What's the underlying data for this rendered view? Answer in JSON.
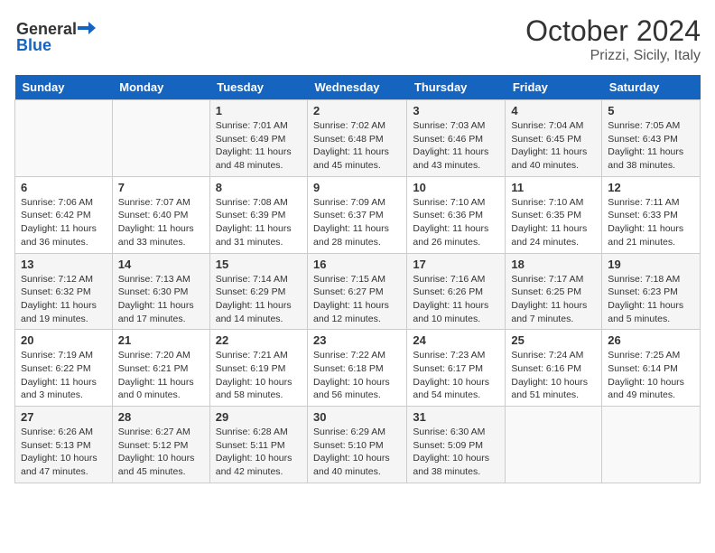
{
  "logo": {
    "line1": "General",
    "line2": "Blue"
  },
  "title": "October 2024",
  "subtitle": "Prizzi, Sicily, Italy",
  "days_of_week": [
    "Sunday",
    "Monday",
    "Tuesday",
    "Wednesday",
    "Thursday",
    "Friday",
    "Saturday"
  ],
  "weeks": [
    [
      {
        "day": "",
        "info": ""
      },
      {
        "day": "",
        "info": ""
      },
      {
        "day": "1",
        "info": "Sunrise: 7:01 AM\nSunset: 6:49 PM\nDaylight: 11 hours and 48 minutes."
      },
      {
        "day": "2",
        "info": "Sunrise: 7:02 AM\nSunset: 6:48 PM\nDaylight: 11 hours and 45 minutes."
      },
      {
        "day": "3",
        "info": "Sunrise: 7:03 AM\nSunset: 6:46 PM\nDaylight: 11 hours and 43 minutes."
      },
      {
        "day": "4",
        "info": "Sunrise: 7:04 AM\nSunset: 6:45 PM\nDaylight: 11 hours and 40 minutes."
      },
      {
        "day": "5",
        "info": "Sunrise: 7:05 AM\nSunset: 6:43 PM\nDaylight: 11 hours and 38 minutes."
      }
    ],
    [
      {
        "day": "6",
        "info": "Sunrise: 7:06 AM\nSunset: 6:42 PM\nDaylight: 11 hours and 36 minutes."
      },
      {
        "day": "7",
        "info": "Sunrise: 7:07 AM\nSunset: 6:40 PM\nDaylight: 11 hours and 33 minutes."
      },
      {
        "day": "8",
        "info": "Sunrise: 7:08 AM\nSunset: 6:39 PM\nDaylight: 11 hours and 31 minutes."
      },
      {
        "day": "9",
        "info": "Sunrise: 7:09 AM\nSunset: 6:37 PM\nDaylight: 11 hours and 28 minutes."
      },
      {
        "day": "10",
        "info": "Sunrise: 7:10 AM\nSunset: 6:36 PM\nDaylight: 11 hours and 26 minutes."
      },
      {
        "day": "11",
        "info": "Sunrise: 7:10 AM\nSunset: 6:35 PM\nDaylight: 11 hours and 24 minutes."
      },
      {
        "day": "12",
        "info": "Sunrise: 7:11 AM\nSunset: 6:33 PM\nDaylight: 11 hours and 21 minutes."
      }
    ],
    [
      {
        "day": "13",
        "info": "Sunrise: 7:12 AM\nSunset: 6:32 PM\nDaylight: 11 hours and 19 minutes."
      },
      {
        "day": "14",
        "info": "Sunrise: 7:13 AM\nSunset: 6:30 PM\nDaylight: 11 hours and 17 minutes."
      },
      {
        "day": "15",
        "info": "Sunrise: 7:14 AM\nSunset: 6:29 PM\nDaylight: 11 hours and 14 minutes."
      },
      {
        "day": "16",
        "info": "Sunrise: 7:15 AM\nSunset: 6:27 PM\nDaylight: 11 hours and 12 minutes."
      },
      {
        "day": "17",
        "info": "Sunrise: 7:16 AM\nSunset: 6:26 PM\nDaylight: 11 hours and 10 minutes."
      },
      {
        "day": "18",
        "info": "Sunrise: 7:17 AM\nSunset: 6:25 PM\nDaylight: 11 hours and 7 minutes."
      },
      {
        "day": "19",
        "info": "Sunrise: 7:18 AM\nSunset: 6:23 PM\nDaylight: 11 hours and 5 minutes."
      }
    ],
    [
      {
        "day": "20",
        "info": "Sunrise: 7:19 AM\nSunset: 6:22 PM\nDaylight: 11 hours and 3 minutes."
      },
      {
        "day": "21",
        "info": "Sunrise: 7:20 AM\nSunset: 6:21 PM\nDaylight: 11 hours and 0 minutes."
      },
      {
        "day": "22",
        "info": "Sunrise: 7:21 AM\nSunset: 6:19 PM\nDaylight: 10 hours and 58 minutes."
      },
      {
        "day": "23",
        "info": "Sunrise: 7:22 AM\nSunset: 6:18 PM\nDaylight: 10 hours and 56 minutes."
      },
      {
        "day": "24",
        "info": "Sunrise: 7:23 AM\nSunset: 6:17 PM\nDaylight: 10 hours and 54 minutes."
      },
      {
        "day": "25",
        "info": "Sunrise: 7:24 AM\nSunset: 6:16 PM\nDaylight: 10 hours and 51 minutes."
      },
      {
        "day": "26",
        "info": "Sunrise: 7:25 AM\nSunset: 6:14 PM\nDaylight: 10 hours and 49 minutes."
      }
    ],
    [
      {
        "day": "27",
        "info": "Sunrise: 6:26 AM\nSunset: 5:13 PM\nDaylight: 10 hours and 47 minutes."
      },
      {
        "day": "28",
        "info": "Sunrise: 6:27 AM\nSunset: 5:12 PM\nDaylight: 10 hours and 45 minutes."
      },
      {
        "day": "29",
        "info": "Sunrise: 6:28 AM\nSunset: 5:11 PM\nDaylight: 10 hours and 42 minutes."
      },
      {
        "day": "30",
        "info": "Sunrise: 6:29 AM\nSunset: 5:10 PM\nDaylight: 10 hours and 40 minutes."
      },
      {
        "day": "31",
        "info": "Sunrise: 6:30 AM\nSunset: 5:09 PM\nDaylight: 10 hours and 38 minutes."
      },
      {
        "day": "",
        "info": ""
      },
      {
        "day": "",
        "info": ""
      }
    ]
  ]
}
